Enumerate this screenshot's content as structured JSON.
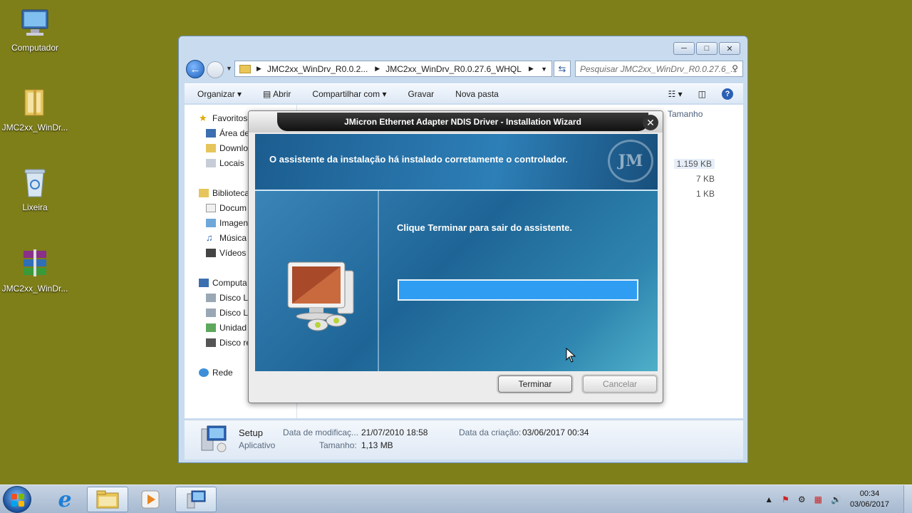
{
  "desktop": {
    "icons": [
      {
        "label": "Computador"
      },
      {
        "label": "JMC2xx_WinDr..."
      },
      {
        "label": "Lixeira"
      },
      {
        "label": "JMC2xx_WinDr..."
      }
    ]
  },
  "explorer": {
    "address": {
      "crumb1": "JMC2xx_WinDrv_R0.0.2...",
      "crumb2": "JMC2xx_WinDrv_R0.0.27.6_WHQL"
    },
    "search_placeholder": "Pesquisar JMC2xx_WinDrv_R0.0.27.6_...",
    "toolbar": {
      "organize": "Organizar",
      "open": "Abrir",
      "share": "Compartilhar com",
      "burn": "Gravar",
      "new_folder": "Nova pasta"
    },
    "nav": {
      "favorites": "Favoritos",
      "desktop": "Área de",
      "downloads": "Downlo",
      "recent": "Locais",
      "libraries": "Biblioteca",
      "documents": "Docum",
      "images": "Imagen",
      "music": "Música",
      "videos": "Vídeos",
      "computer": "Computa",
      "disk1": "Disco L",
      "disk2": "Disco L",
      "drive": "Unidad",
      "disk3": "Disco re",
      "network": "Rede"
    },
    "columns": {
      "size": "Tamanho"
    },
    "sizes": [
      "1.159 KB",
      "7 KB",
      "1 KB"
    ],
    "details": {
      "name": "Setup",
      "type": "Aplicativo",
      "modified_label": "Data de modificaç...",
      "modified_value": "21/07/2010 18:58",
      "size_label": "Tamanho:",
      "size_value": "1,13 MB",
      "created_label": "Data da criação:",
      "created_value": "03/06/2017 00:34"
    }
  },
  "dialog": {
    "title": "JMicron Ethernet Adapter NDIS Driver - Installation Wizard",
    "header_text": "O assistente da instalação há instalado corretamente o controlador.",
    "logo": "JM",
    "message": "Clique Terminar para sair do assistente.",
    "progress": 1.0,
    "finish": "Terminar",
    "cancel": "Cancelar"
  },
  "taskbar": {
    "time": "00:34",
    "date": "03/06/2017"
  }
}
